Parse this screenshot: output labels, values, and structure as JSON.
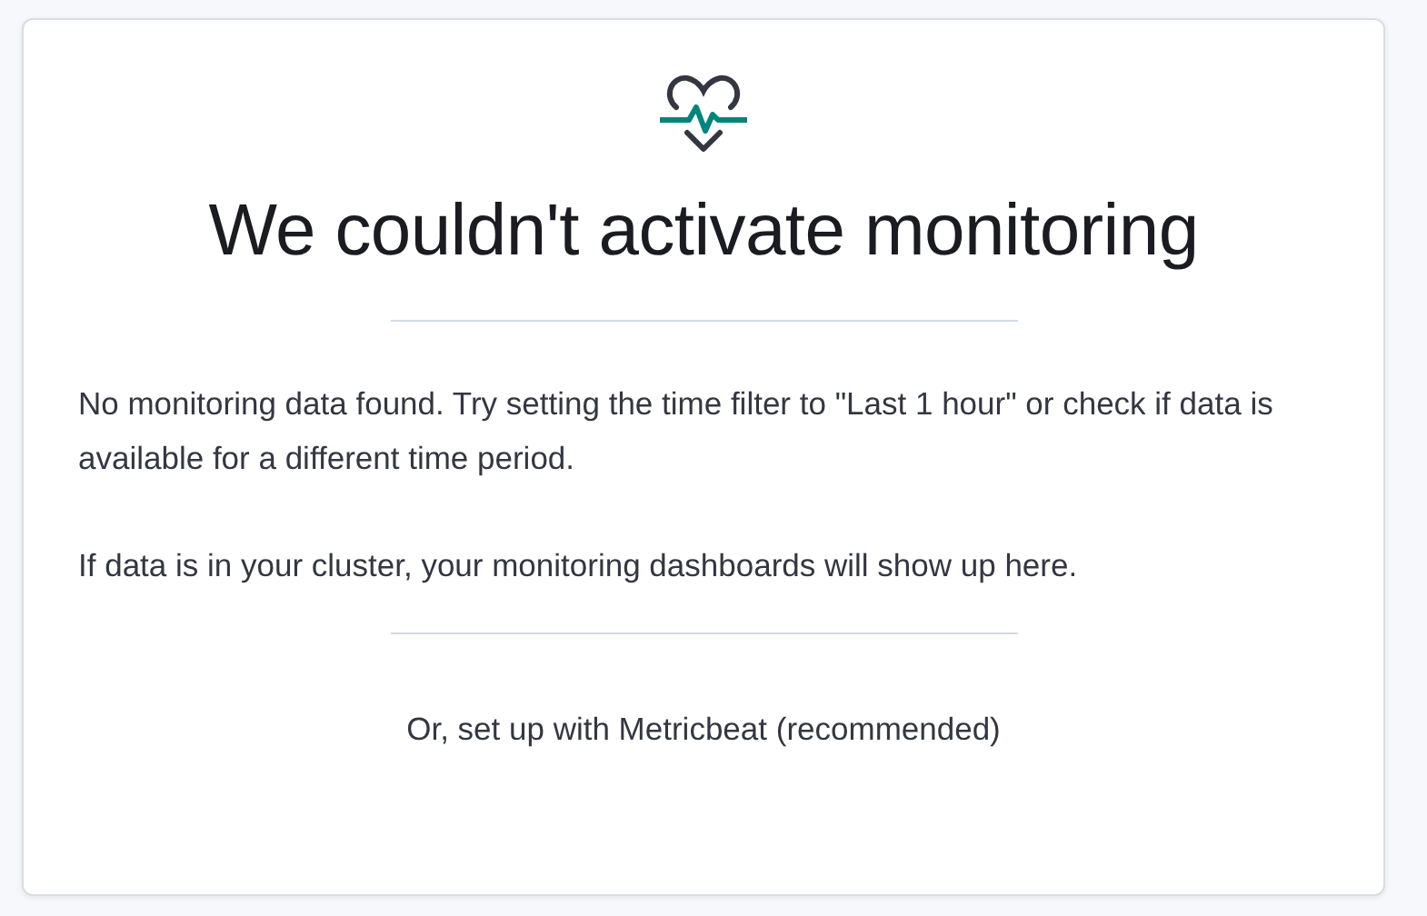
{
  "title": "We couldn't activate monitoring",
  "paragraphs": [
    "No monitoring data found. Try setting the time filter to \"Last 1 hour\" or check if data is available for a different time period.",
    "If data is in your cluster, your monitoring dashboards will show up here."
  ],
  "footer_text": "Or, set up with Metricbeat (recommended)"
}
